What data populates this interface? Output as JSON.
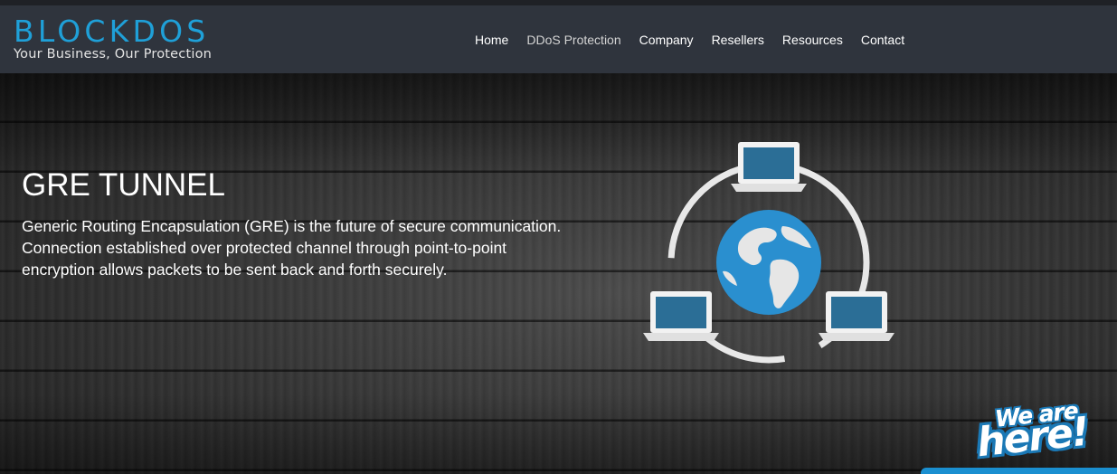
{
  "brand": {
    "name": "BLOCKDOS",
    "tagline": "Your Business, Our Protection",
    "accent_color": "#1fa0d8"
  },
  "nav": {
    "items": [
      {
        "label": "Home"
      },
      {
        "label": "DDoS Protection",
        "active": true
      },
      {
        "label": "Company"
      },
      {
        "label": "Resellers"
      },
      {
        "label": "Resources"
      },
      {
        "label": "Contact"
      }
    ]
  },
  "hero": {
    "title": "GRE TUNNEL",
    "description": "Generic Routing Encapsulation (GRE) is the future of secure communication. Connection established over protected channel through point-to-point encryption allows packets to be sent back and forth securely.",
    "graphic_icon": "network-globe-laptops-icon"
  },
  "chat_badge": {
    "line1": "We are",
    "line2": "here!",
    "color": "#1a8fd0"
  }
}
